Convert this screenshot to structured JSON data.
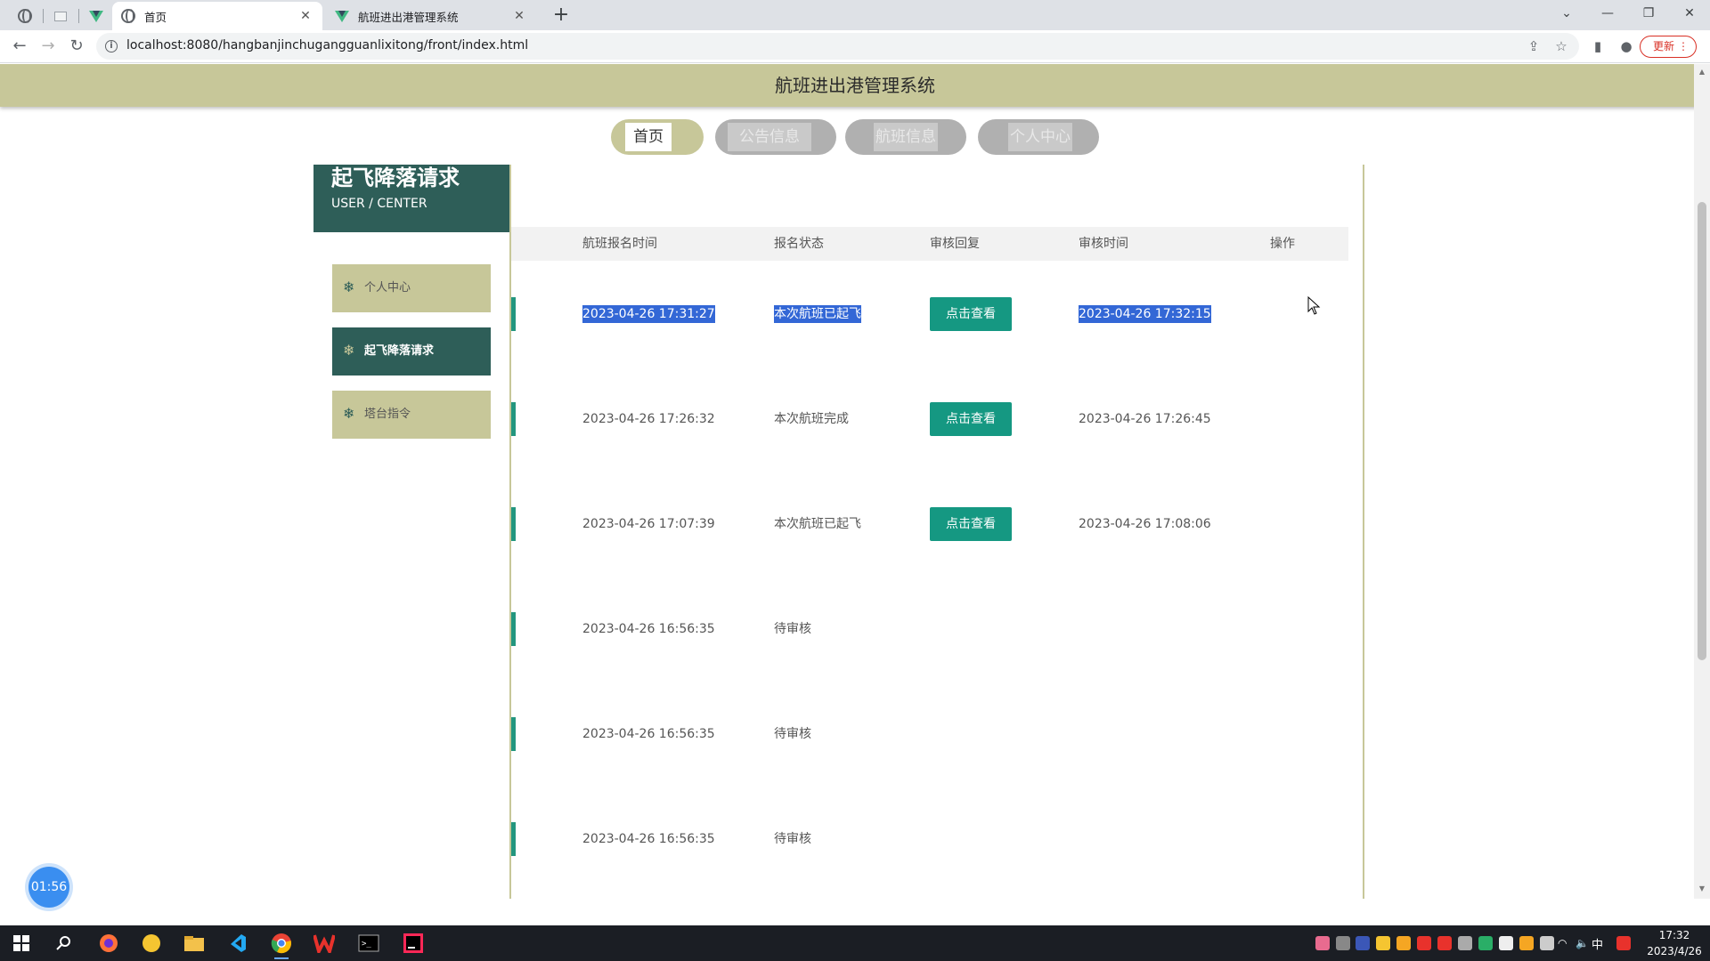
{
  "browser": {
    "tabs": [
      {
        "title": "首页",
        "icon": "globe-icon",
        "active": true
      },
      {
        "title": "航班进出港管理系统",
        "icon": "vue-icon",
        "active": false
      }
    ],
    "url": "localhost:8080/hangbanjinchugangguanlixitong/front/index.html",
    "update_label": "更新"
  },
  "site": {
    "title": "航班进出港管理系统",
    "nav": [
      "首页",
      "公告信息",
      "航班信息",
      "个人中心"
    ]
  },
  "sidebar": {
    "title": "起飞降落请求",
    "subtitle": "USER / CENTER",
    "items": [
      "个人中心",
      "起飞降落请求",
      "塔台指令"
    ]
  },
  "table": {
    "headers": [
      "航班报名时间",
      "报名状态",
      "审核回复",
      "审核时间",
      "操作"
    ],
    "rows": [
      {
        "time": "2023-04-26 17:31:27",
        "status": "本次航班已起飞",
        "reply": "点击查看",
        "audit_time": "2023-04-26 17:32:15",
        "selected": true
      },
      {
        "time": "2023-04-26 17:26:32",
        "status": "本次航班完成",
        "reply": "点击查看",
        "audit_time": "2023-04-26 17:26:45"
      },
      {
        "time": "2023-04-26 17:07:39",
        "status": "本次航班已起飞",
        "reply": "点击查看",
        "audit_time": "2023-04-26 17:08:06"
      },
      {
        "time": "2023-04-26 16:56:35",
        "status": "待审核",
        "reply": "",
        "audit_time": ""
      },
      {
        "time": "2023-04-26 16:56:35",
        "status": "待审核",
        "reply": "",
        "audit_time": ""
      },
      {
        "time": "2023-04-26 16:56:35",
        "status": "待审核",
        "reply": "",
        "audit_time": ""
      }
    ]
  },
  "timer": "01:56",
  "system": {
    "time": "17:32",
    "date": "2023/4/26",
    "ime": "中"
  },
  "colors": {
    "accent": "#c7c799",
    "dark_green": "#2e5e58",
    "button": "#159882",
    "selection": "#3367d6"
  }
}
